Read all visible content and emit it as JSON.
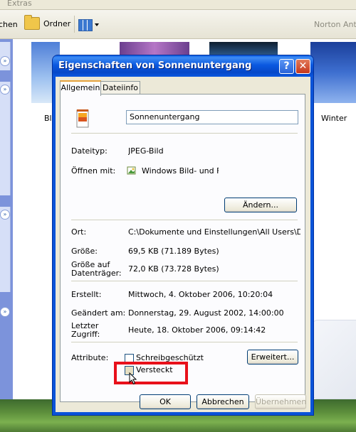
{
  "explorer": {
    "menu_extras": "Extras",
    "toolbar_prev_label": "chen",
    "toolbar_folders_label": "Ordner",
    "toolbar_norton": "Norton AntiV",
    "thumb_label_left": "Bla",
    "thumb_label_right": "Winter"
  },
  "dialog": {
    "title": "Eigenschaften von Sonnenuntergang",
    "help_glyph": "?",
    "close_glyph": "✕",
    "tabs": [
      {
        "label": "Allgemein",
        "active": true
      },
      {
        "label": "Dateiinfo",
        "active": false
      }
    ],
    "filename_value": "Sonnenuntergang",
    "labels": {
      "type": "Dateityp:",
      "opens_with": "Öffnen mit:",
      "location": "Ort:",
      "size": "Größe:",
      "size_on_disk_1": "Größe auf",
      "size_on_disk_2": "Datenträger:",
      "created": "Erstellt:",
      "modified": "Geändert am:",
      "accessed_1": "Letzter",
      "accessed_2": "Zugriff:",
      "attributes": "Attribute:"
    },
    "values": {
      "type": "JPEG-Bild",
      "opens_with": "Windows Bild- und Fax",
      "location": "C:\\Dokumente und Einstellungen\\All Users\\Dokume",
      "size": "69,5 KB (71.189 Bytes)",
      "size_on_disk": "72,0 KB (73.728 Bytes)",
      "created": "Mittwoch, 4. Oktober 2006, 10:20:04",
      "modified": "Donnerstag, 29. August 2002, 14:00:00",
      "accessed": "Heute, 18. Oktober 2006, 09:14:42"
    },
    "attributes": {
      "readonly_label": "Schreibgeschützt",
      "readonly_checked": false,
      "hidden_label": "Versteckt",
      "hidden_checked": false
    },
    "buttons": {
      "change": "Ändern...",
      "advanced": "Erweitert...",
      "ok": "OK",
      "cancel": "Abbrechen",
      "apply": "Übernehmen"
    },
    "colors": {
      "titlebar": "#0a58e0",
      "highlight": "#e8101a",
      "tab_accent": "#e6a23c"
    }
  }
}
